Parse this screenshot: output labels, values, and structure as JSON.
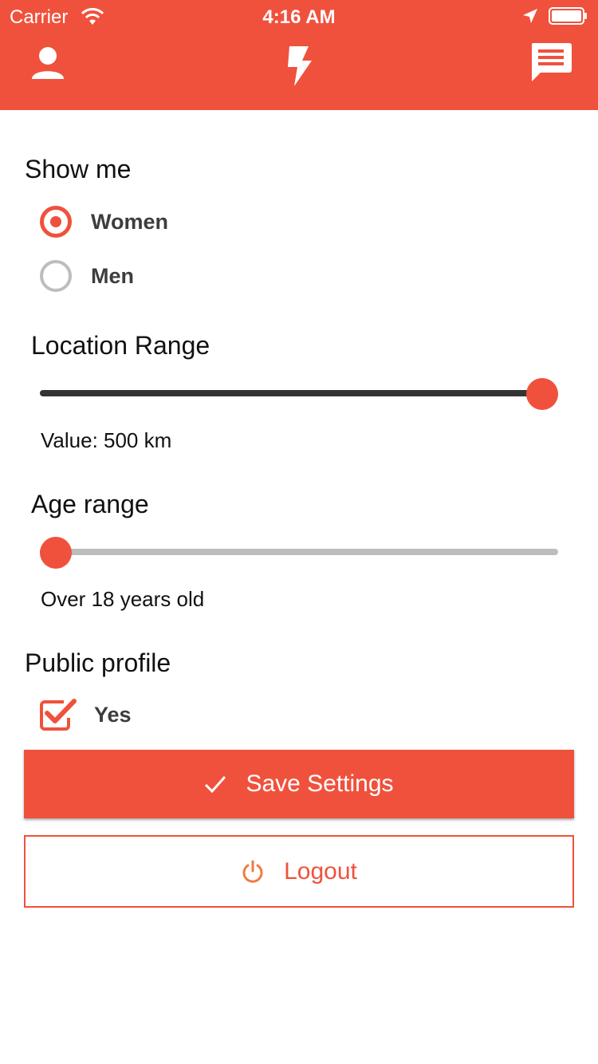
{
  "status_bar": {
    "carrier": "Carrier",
    "time": "4:16 AM"
  },
  "nav": {
    "left_icon": "profile-icon",
    "center_icon": "bolt-icon",
    "right_icon": "chat-icon"
  },
  "show_me": {
    "title": "Show me",
    "options": [
      {
        "label": "Women",
        "selected": true
      },
      {
        "label": "Men",
        "selected": false
      }
    ]
  },
  "location_range": {
    "title": "Location Range",
    "value_text": "Value: 500 km",
    "fraction": 1.0
  },
  "age_range": {
    "title": "Age range",
    "value_text": "Over 18 years old",
    "fraction": 0.0
  },
  "public_profile": {
    "title": "Public profile",
    "option_label": "Yes",
    "checked": true
  },
  "buttons": {
    "save_label": "Save Settings",
    "save_icon": "check-icon",
    "logout_label": "Logout",
    "logout_icon": "power-icon"
  },
  "colors": {
    "accent": "#F0513C",
    "track": "#BDBDBD",
    "track_fill": "#333333"
  }
}
